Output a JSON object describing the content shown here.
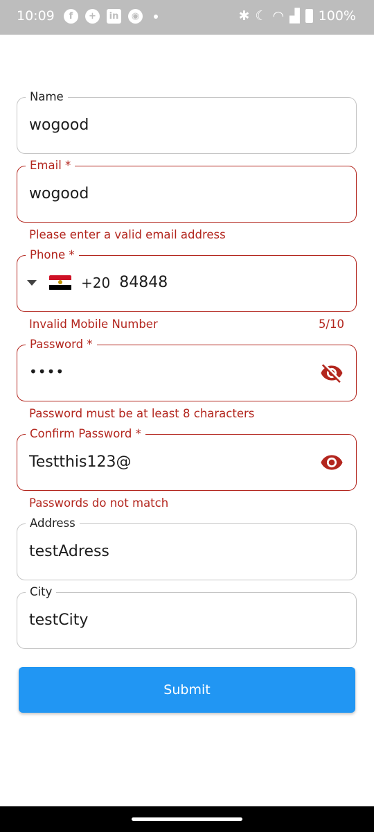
{
  "status": {
    "time": "10:09",
    "left_icons": [
      "facebook-icon",
      "add-circle-icon",
      "linkedin-icon",
      "app-icon"
    ],
    "battery": "100%"
  },
  "form": {
    "name": {
      "label": "Name",
      "value": "wogood"
    },
    "email": {
      "label": "Email *",
      "value": "wogood",
      "error": "Please enter a valid email address"
    },
    "phone": {
      "label": "Phone *",
      "country_flag": "egypt-flag",
      "dial_code": "+20",
      "value": "84848",
      "error": "Invalid Mobile Number",
      "counter": "5/10"
    },
    "password": {
      "label": "Password *",
      "value": "••••",
      "error": "Password must be at least 8 characters"
    },
    "confirm_password": {
      "label": "Confirm Password *",
      "value": "Testthis123@",
      "error": "Passwords do not match"
    },
    "address": {
      "label": "Address",
      "value": "testAdress"
    },
    "city": {
      "label": "City",
      "value": "testCity"
    },
    "submit_label": "Submit"
  },
  "colors": {
    "error": "#b3261e",
    "accent": "#2196f3",
    "border": "#c4c4c4"
  }
}
